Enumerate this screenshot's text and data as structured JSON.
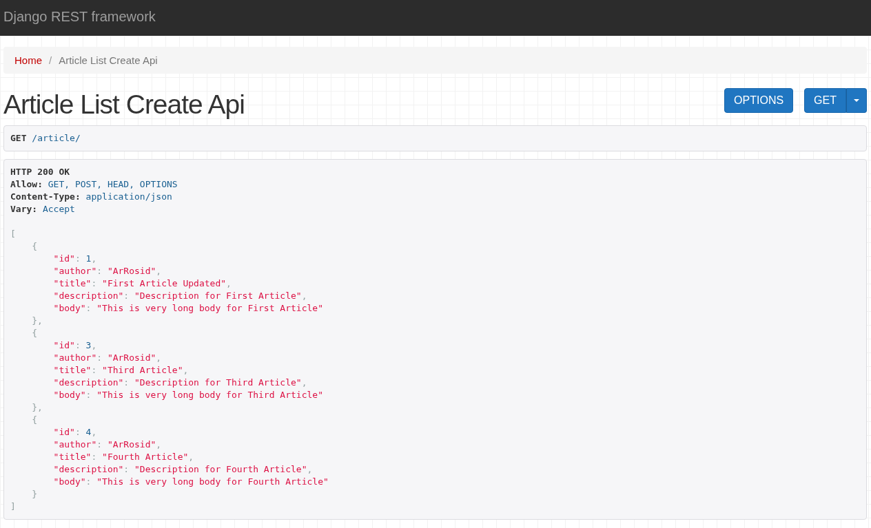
{
  "navbar": {
    "brand": "Django REST framework"
  },
  "breadcrumb": [
    {
      "label": "Home",
      "active": false
    },
    {
      "label": "/",
      "kind": "separator"
    },
    {
      "label": "Article List Create Api",
      "active": true
    }
  ],
  "title": "Article List Create Api",
  "buttons": [
    {
      "label": "OPTIONS",
      "kind": "button"
    },
    {
      "label": "GET",
      "kind": "split"
    }
  ],
  "request": {
    "method": "GET",
    "path": "/article/"
  },
  "response": {
    "status": "HTTP 200 OK",
    "headers": [
      {
        "name": "Allow:",
        "value": "GET, POST, HEAD, OPTIONS"
      },
      {
        "name": "Content-Type:",
        "value": "application/json"
      },
      {
        "name": "Vary:",
        "value": "Accept"
      }
    ],
    "body": {
      "open": "[",
      "close": "]",
      "children": [
        {
          "open": "{",
          "close": "},",
          "fields": [
            [
              {
                "text": "\"id\"",
                "kind": "str"
              },
              {
                "text": ": ",
                "kind": "pun"
              },
              {
                "text": "1",
                "kind": "lit"
              },
              {
                "text": ",",
                "kind": "pun"
              }
            ],
            [
              {
                "text": "\"author\"",
                "kind": "str"
              },
              {
                "text": ": ",
                "kind": "pun"
              },
              {
                "text": "\"ArRosid\"",
                "kind": "str"
              },
              {
                "text": ",",
                "kind": "pun"
              }
            ],
            [
              {
                "text": "\"title\"",
                "kind": "str"
              },
              {
                "text": ": ",
                "kind": "pun"
              },
              {
                "text": "\"First Article Updated\"",
                "kind": "str"
              },
              {
                "text": ",",
                "kind": "pun"
              }
            ],
            [
              {
                "text": "\"description\"",
                "kind": "str"
              },
              {
                "text": ": ",
                "kind": "pun"
              },
              {
                "text": "\"Description for First Article\"",
                "kind": "str"
              },
              {
                "text": ",",
                "kind": "pun"
              }
            ],
            [
              {
                "text": "\"body\"",
                "kind": "str"
              },
              {
                "text": ": ",
                "kind": "pun"
              },
              {
                "text": "\"This is very long body for First Article\"",
                "kind": "str"
              }
            ]
          ]
        },
        {
          "open": "{",
          "close": "},",
          "fields": [
            [
              {
                "text": "\"id\"",
                "kind": "str"
              },
              {
                "text": ": ",
                "kind": "pun"
              },
              {
                "text": "3",
                "kind": "lit"
              },
              {
                "text": ",",
                "kind": "pun"
              }
            ],
            [
              {
                "text": "\"author\"",
                "kind": "str"
              },
              {
                "text": ": ",
                "kind": "pun"
              },
              {
                "text": "\"ArRosid\"",
                "kind": "str"
              },
              {
                "text": ",",
                "kind": "pun"
              }
            ],
            [
              {
                "text": "\"title\"",
                "kind": "str"
              },
              {
                "text": ": ",
                "kind": "pun"
              },
              {
                "text": "\"Third Article\"",
                "kind": "str"
              },
              {
                "text": ",",
                "kind": "pun"
              }
            ],
            [
              {
                "text": "\"description\"",
                "kind": "str"
              },
              {
                "text": ": ",
                "kind": "pun"
              },
              {
                "text": "\"Description for Third Article\"",
                "kind": "str"
              },
              {
                "text": ",",
                "kind": "pun"
              }
            ],
            [
              {
                "text": "\"body\"",
                "kind": "str"
              },
              {
                "text": ": ",
                "kind": "pun"
              },
              {
                "text": "\"This is very long body for Third Article\"",
                "kind": "str"
              }
            ]
          ]
        },
        {
          "open": "{",
          "close": "}",
          "fields": [
            [
              {
                "text": "\"id\"",
                "kind": "str"
              },
              {
                "text": ": ",
                "kind": "pun"
              },
              {
                "text": "4",
                "kind": "lit"
              },
              {
                "text": ",",
                "kind": "pun"
              }
            ],
            [
              {
                "text": "\"author\"",
                "kind": "str"
              },
              {
                "text": ": ",
                "kind": "pun"
              },
              {
                "text": "\"ArRosid\"",
                "kind": "str"
              },
              {
                "text": ",",
                "kind": "pun"
              }
            ],
            [
              {
                "text": "\"title\"",
                "kind": "str"
              },
              {
                "text": ": ",
                "kind": "pun"
              },
              {
                "text": "\"Fourth Article\"",
                "kind": "str"
              },
              {
                "text": ",",
                "kind": "pun"
              }
            ],
            [
              {
                "text": "\"description\"",
                "kind": "str"
              },
              {
                "text": ": ",
                "kind": "pun"
              },
              {
                "text": "\"Description for Fourth Article\"",
                "kind": "str"
              },
              {
                "text": ",",
                "kind": "pun"
              }
            ],
            [
              {
                "text": "\"body\"",
                "kind": "str"
              },
              {
                "text": ": ",
                "kind": "pun"
              },
              {
                "text": "\"This is very long body for Fourth Article\"",
                "kind": "str"
              }
            ]
          ]
        }
      ]
    }
  }
}
